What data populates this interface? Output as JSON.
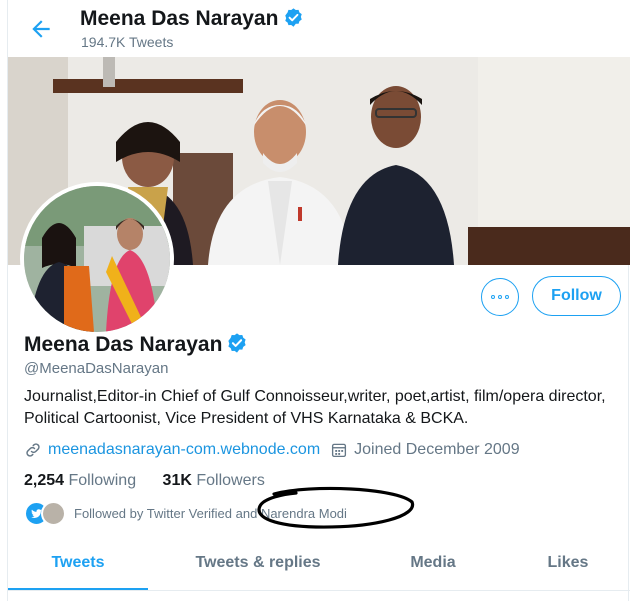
{
  "header": {
    "name": "Meena Das Narayan",
    "tweets_count": "194.7K Tweets"
  },
  "profile": {
    "name": "Meena Das Narayan",
    "handle": "@MeenaDasNarayan",
    "bio": "Journalist,Editor-in Chief of Gulf Connoisseur,writer, poet,artist, film/opera director, Political Cartoonist, Vice President of VHS Karnataka &  BCKA.",
    "website": "meenadasnarayan-com.webnode.com",
    "joined": "Joined December 2009",
    "following_count": "2,254",
    "following_label": "Following",
    "followers_count": "31K",
    "followers_label": "Followers",
    "followed_by_prefix": "Followed by Twitter Verified and",
    "followed_by_name": "Narendra Modi"
  },
  "actions": {
    "follow_label": "Follow"
  },
  "tabs": [
    {
      "label": "Tweets",
      "active": true
    },
    {
      "label": "Tweets & replies",
      "active": false
    },
    {
      "label": "Media",
      "active": false
    },
    {
      "label": "Likes",
      "active": false
    }
  ],
  "colors": {
    "accent": "#1da1f2",
    "text": "#14171a",
    "muted": "#657786",
    "link": "#1b95e0"
  },
  "icons": [
    "back-arrow-icon",
    "verified-badge-icon",
    "more-icon",
    "link-icon",
    "calendar-icon"
  ]
}
